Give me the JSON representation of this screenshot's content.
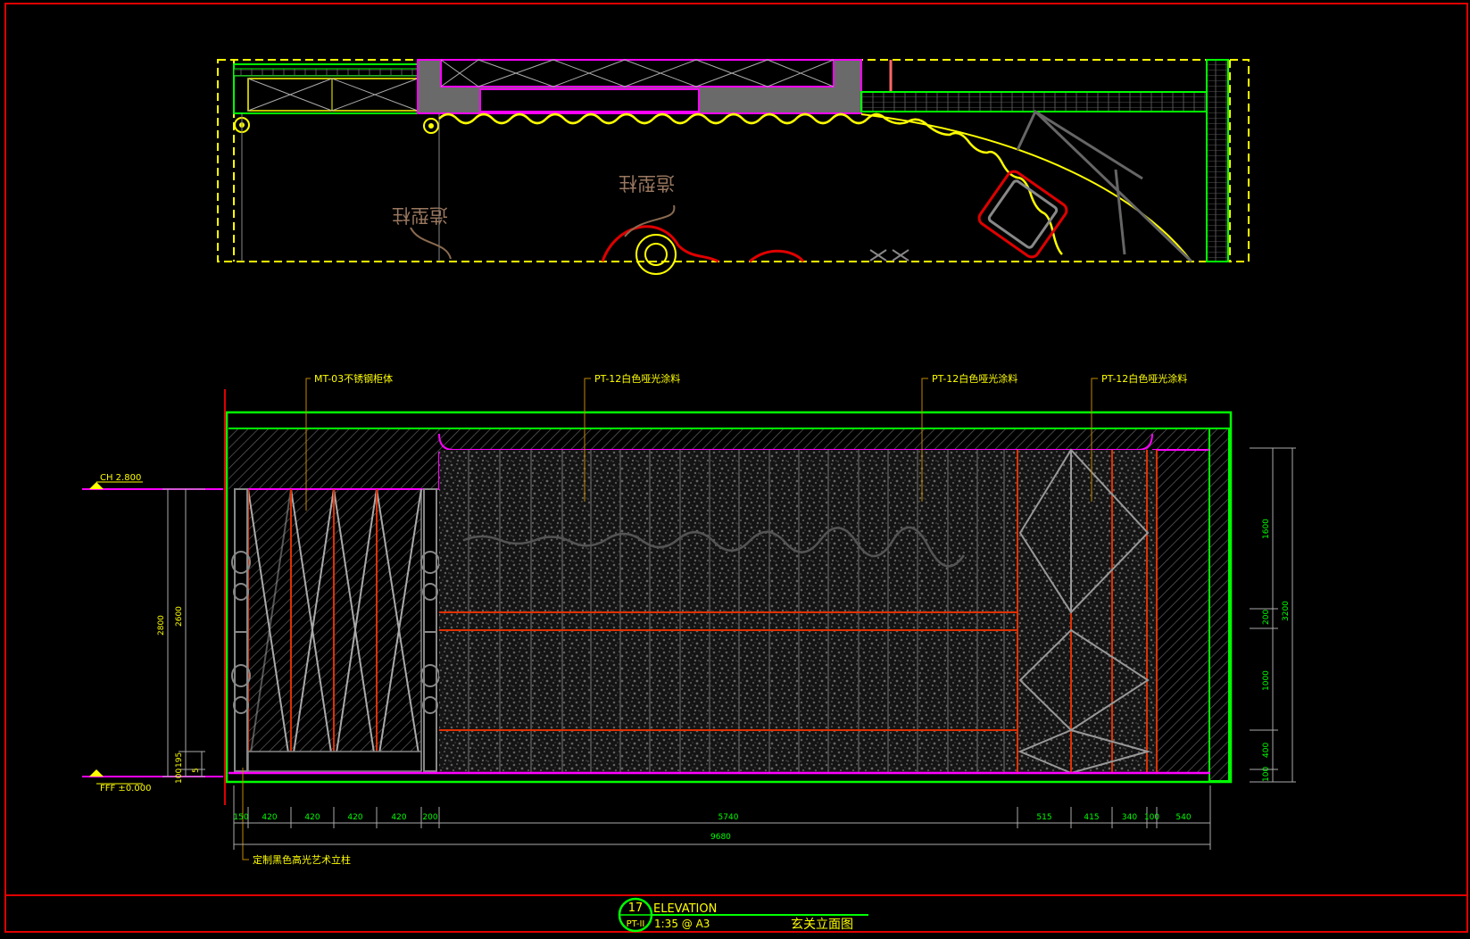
{
  "plan": {
    "labels": [
      {
        "id": "plan-label-1",
        "text": "造型柱"
      },
      {
        "id": "plan-label-2",
        "text": "造型柱"
      }
    ]
  },
  "elevation": {
    "callouts": [
      {
        "id": "callout-mt03",
        "text": "MT-03不锈钢柜体"
      },
      {
        "id": "callout-pt12-a",
        "text": "PT-12白色哑光涂料"
      },
      {
        "id": "callout-pt12-b",
        "text": "PT-12白色哑光涂料"
      },
      {
        "id": "callout-pt12-c",
        "text": "PT-12白色哑光涂料"
      },
      {
        "id": "callout-column",
        "text": "定制黑色高光艺术立柱"
      }
    ],
    "levels": {
      "ceiling": "CH 2.800",
      "floor": "FFF ±0.000"
    },
    "dims_left": {
      "outer": "2800",
      "inner": "2600",
      "base_a": "100",
      "base_b": "195",
      "base_c": "5"
    },
    "dims_right": {
      "total": "3200",
      "segments": [
        "1600",
        "200",
        "1000",
        "400",
        "100"
      ]
    },
    "dims_bottom": {
      "segments": [
        "150",
        "420",
        "420",
        "420",
        "420",
        "200",
        "5740",
        "515",
        "415",
        "340",
        "100",
        "540"
      ],
      "total": "9680"
    }
  },
  "title_block": {
    "number": "17",
    "sheet": "PT-II",
    "title": "ELEVATION",
    "scale": "1:35 @ A3",
    "name_cn": "玄关立面图"
  }
}
